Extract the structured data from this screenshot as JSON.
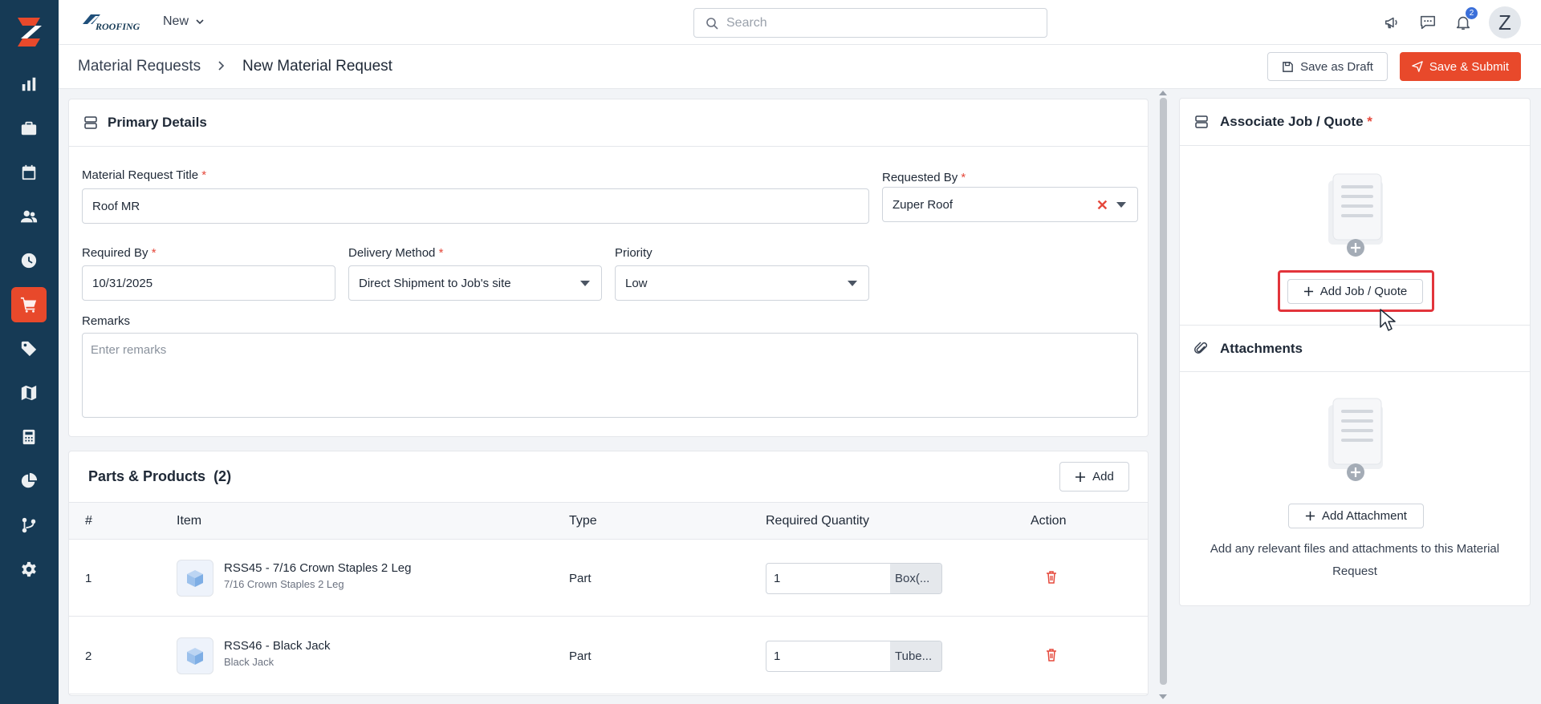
{
  "brand": {
    "logo_text": "ROOFING"
  },
  "nav": {
    "new_label": "New",
    "sidebar": [
      "logo",
      "reports",
      "jobs",
      "schedule",
      "customers",
      "timesheets",
      "material-requests",
      "pricing",
      "map",
      "estimates",
      "analytics",
      "workflows",
      "settings"
    ],
    "active": "material-requests"
  },
  "search": {
    "placeholder": "Search"
  },
  "notifications": {
    "count": "2"
  },
  "user": {
    "initial": "Z"
  },
  "breadcrumb": {
    "parent": "Material Requests",
    "current": "New Material Request"
  },
  "actions": {
    "save_draft": "Save as Draft",
    "save_submit": "Save & Submit"
  },
  "primary": {
    "title": "Primary Details",
    "fields": {
      "title_label": "Material Request Title",
      "title_value": "Roof MR",
      "requested_by_label": "Requested By",
      "requested_by_value": "Zuper Roof",
      "required_by_label": "Required By",
      "required_by_value": "10/31/2025",
      "delivery_label": "Delivery Method",
      "delivery_value": "Direct Shipment to Job's site",
      "priority_label": "Priority",
      "priority_value": "Low",
      "remarks_label": "Remarks",
      "remarks_placeholder": "Enter remarks"
    },
    "required_mark": "*"
  },
  "parts": {
    "title": "Parts & Products",
    "count": "(2)",
    "add_label": "Add",
    "columns": {
      "num": "#",
      "item": "Item",
      "type": "Type",
      "qty": "Required Quantity",
      "action": "Action"
    },
    "rows": [
      {
        "num": "1",
        "name": "RSS45 - 7/16 Crown Staples 2 Leg",
        "sub": "7/16 Crown Staples 2 Leg",
        "type": "Part",
        "qty": "1",
        "unit": "Box(..."
      },
      {
        "num": "2",
        "name": "RSS46 - Black Jack",
        "sub": "Black Jack",
        "type": "Part",
        "qty": "1",
        "unit": "Tube..."
      }
    ]
  },
  "associate": {
    "title": "Associate Job / Quote",
    "button": "Add Job / Quote"
  },
  "attachments": {
    "title": "Attachments",
    "button": "Add Attachment",
    "help": "Add any relevant files and attachments to this Material Request"
  },
  "colors": {
    "sidebar": "#163a55",
    "accent": "#e8492b",
    "highlight": "#e2343b",
    "required": "#e5483b"
  }
}
